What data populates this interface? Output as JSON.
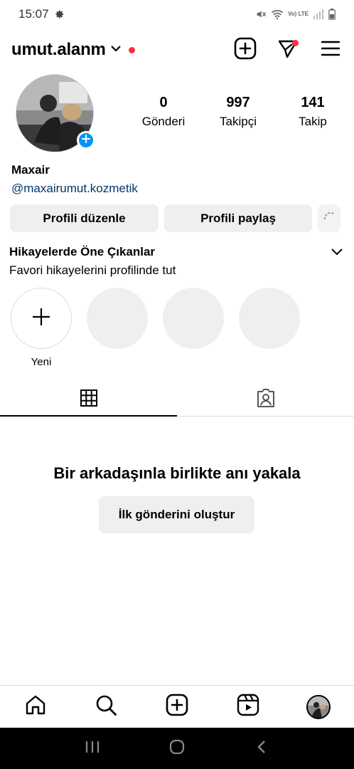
{
  "status_bar": {
    "time": "15:07",
    "lte_label": "Vo) LTE",
    "icons": [
      "gear-icon",
      "mute-icon",
      "wifi-icon",
      "signal-icon",
      "battery-icon"
    ]
  },
  "header": {
    "username": "umut.alanm",
    "has_notification_dot": true,
    "icons": [
      "chevron-down-icon",
      "new-post-icon",
      "threads-icon",
      "menu-icon"
    ]
  },
  "profile": {
    "stats": [
      {
        "value": "0",
        "label": "Gönderi"
      },
      {
        "value": "997",
        "label": "Takipçi"
      },
      {
        "value": "141",
        "label": "Takip"
      }
    ],
    "name": "Maxair",
    "link": "@maxairumut.kozmetik"
  },
  "buttons": {
    "edit": "Profili düzenle",
    "share": "Profili paylaş"
  },
  "highlights": {
    "title": "Hikayelerde Öne Çıkanlar",
    "subtitle": "Favori hikayelerini profilinde tut",
    "new_label": "Yeni"
  },
  "empty_state": {
    "title": "Bir arkadaşınla birlikte anı yakala",
    "button": "İlk gönderini oluştur"
  },
  "colors": {
    "accent": "#0095f6",
    "notification": "#ff3040",
    "link": "#00376b",
    "button_bg": "#efefef"
  }
}
